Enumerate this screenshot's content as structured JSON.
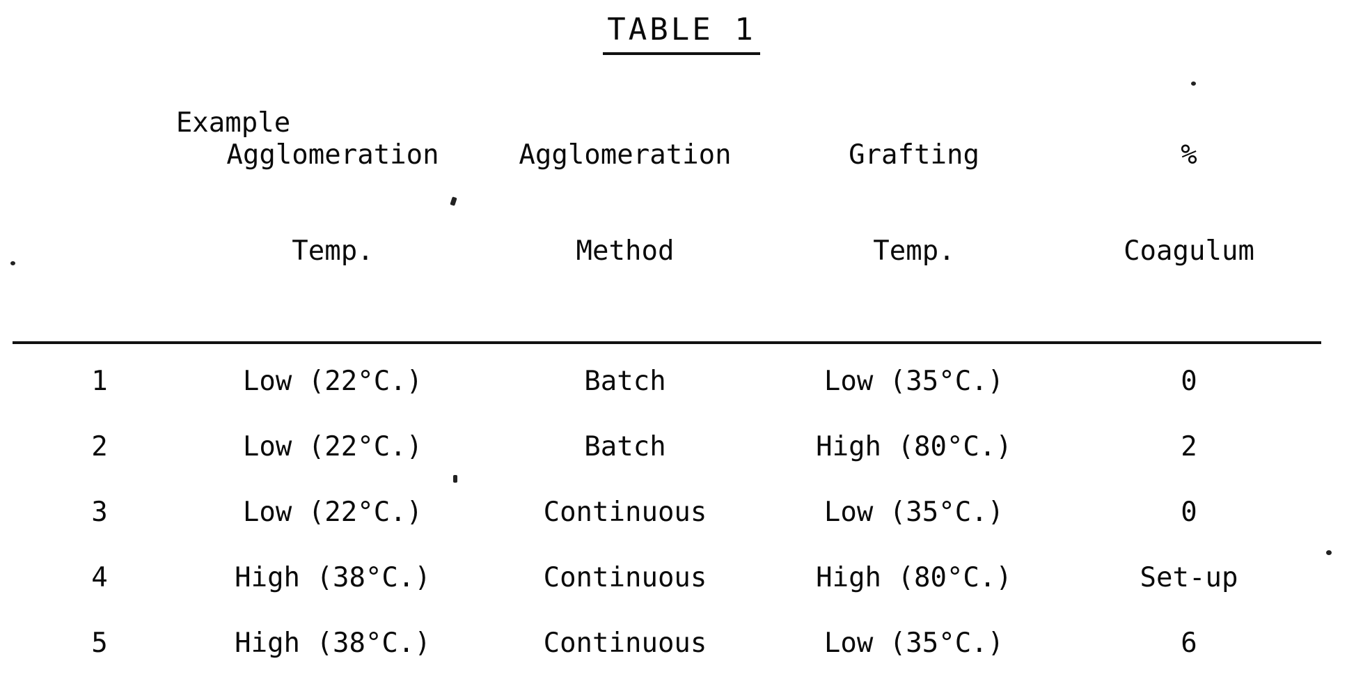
{
  "document": {
    "title": "TABLE 1"
  },
  "table": {
    "headers": [
      {
        "line1": "",
        "line2": "Example"
      },
      {
        "line1": "Agglomeration",
        "line2": "Temp."
      },
      {
        "line1": "Agglomeration",
        "line2": "Method"
      },
      {
        "line1": "Grafting",
        "line2": "Temp."
      },
      {
        "line1": "%",
        "line2": "Coagulum"
      }
    ],
    "rows": [
      {
        "example": "1",
        "agglomeration_temp": "Low (22°C.)",
        "agglomeration_method": "Batch",
        "grafting_temp": "Low (35°C.)",
        "percent_coagulum": "0"
      },
      {
        "example": "2",
        "agglomeration_temp": "Low (22°C.)",
        "agglomeration_method": "Batch",
        "grafting_temp": "High (80°C.)",
        "percent_coagulum": "2"
      },
      {
        "example": "3",
        "agglomeration_temp": "Low (22°C.)",
        "agglomeration_method": "Continuous",
        "grafting_temp": "Low (35°C.)",
        "percent_coagulum": "0"
      },
      {
        "example": "4",
        "agglomeration_temp": "High (38°C.)",
        "agglomeration_method": "Continuous",
        "grafting_temp": "High (80°C.)",
        "percent_coagulum": "Set-up"
      },
      {
        "example": "5",
        "agglomeration_temp": "High (38°C.)",
        "agglomeration_method": "Continuous",
        "grafting_temp": "Low (35°C.)",
        "percent_coagulum": "6"
      }
    ]
  },
  "colors": {
    "ink": "#0a0a0a",
    "paper": "#ffffff"
  }
}
